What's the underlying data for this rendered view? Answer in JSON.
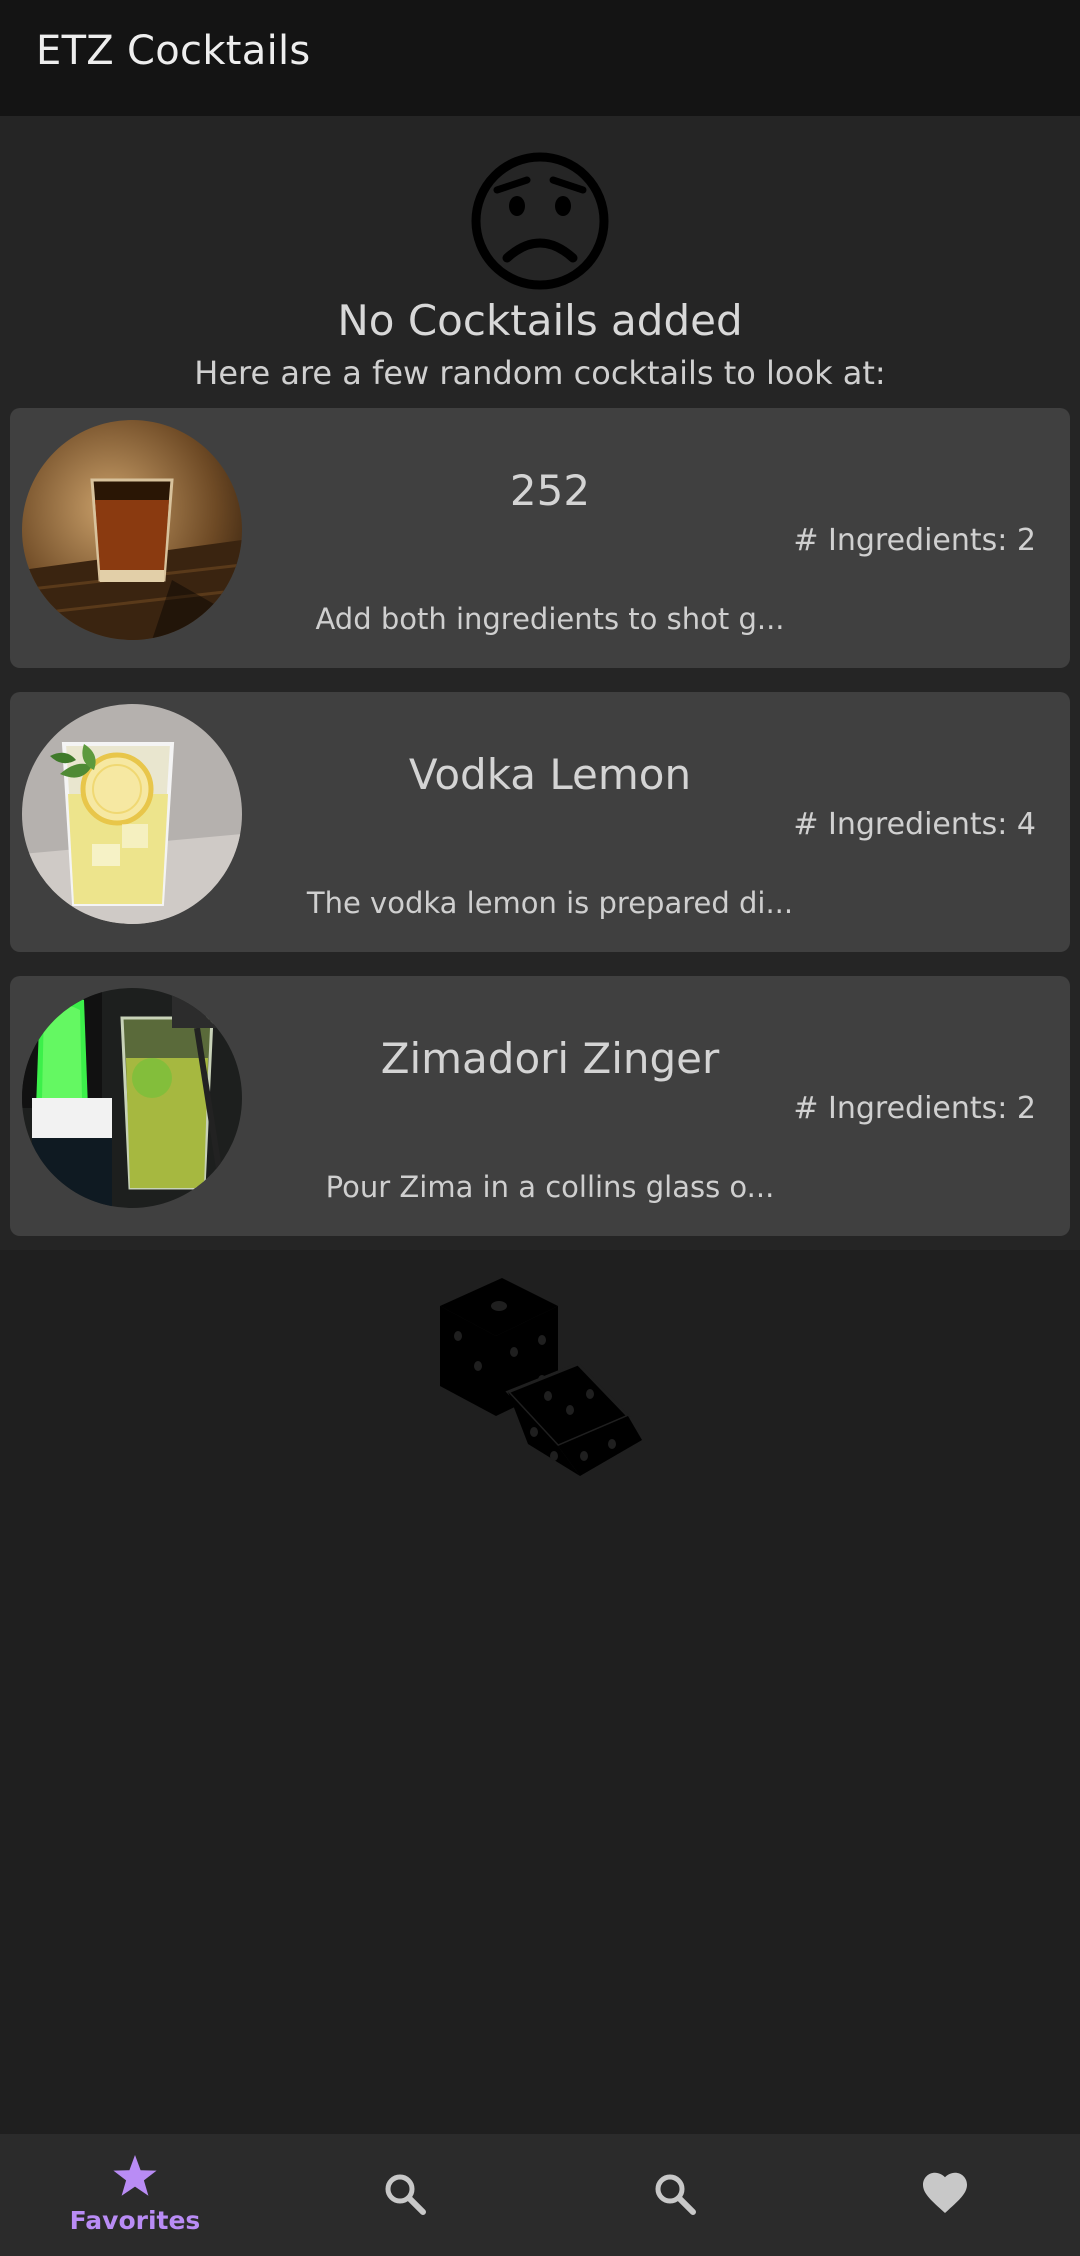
{
  "app_bar": {
    "title": "ETZ Cocktails"
  },
  "empty_state": {
    "icon": "sad-face-icon",
    "title": "No Cocktails added",
    "subtitle": "Here are a few random cocktails to look at:"
  },
  "cocktails": [
    {
      "name": "252",
      "ingredients": "# Ingredients: 2",
      "description": "Add both ingredients to shot g...",
      "image": "shot-glass-photo"
    },
    {
      "name": "Vodka Lemon",
      "ingredients": "# Ingredients: 4",
      "description": "The vodka lemon is prepared di...",
      "image": "lemon-drink-photo"
    },
    {
      "name": "Zimadori Zinger",
      "ingredients": "# Ingredients: 2",
      "description": "Pour Zima in a collins glass o...",
      "image": "midori-drink-photo"
    }
  ],
  "randomize": {
    "icon": "dice-icon"
  },
  "bottom_nav": {
    "items": [
      {
        "label": "Favorites",
        "icon": "star-icon",
        "selected": true
      },
      {
        "label": "",
        "icon": "search-icon",
        "selected": false
      },
      {
        "label": "",
        "icon": "search-icon",
        "selected": false
      },
      {
        "label": "",
        "icon": "heart-icon",
        "selected": false
      }
    ]
  },
  "colors": {
    "app_bar": "#141414",
    "background": "#1f1f1f",
    "panel": "#252525",
    "card": "#404040",
    "nav_bar": "#2b2b2b",
    "accent": "#b98cf5",
    "icon_inactive": "#c8c8c8"
  }
}
